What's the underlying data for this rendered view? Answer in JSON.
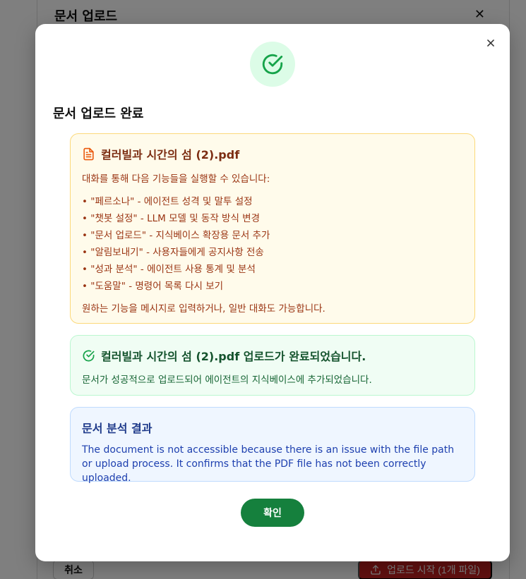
{
  "background": {
    "dialog_title": "문서 업로드",
    "cancel_label": "취소",
    "upload_button_label": "업로드 시작 (1개 파일)"
  },
  "modal": {
    "title": "문서 업로드 완료",
    "info_card": {
      "file_name": "컬러빌과 시간의 섬 (2).pdf",
      "intro": "대화를 통해 다음 기능들을 실행할 수 있습니다:",
      "features": [
        "• \"페르소나\" - 에이전트 성격 및 말투 설정",
        "• \"챗봇 설정\" - LLM 모델 및 동작 방식 변경",
        "• \"문서 업로드\" - 지식베이스 확장용 문서 추가",
        "• \"알림보내기\" - 사용자들에게 공지사항 전송",
        "• \"성과 분석\" - 에이전트 사용 통계 및 분석",
        "• \"도움말\" - 명령어 목록 다시 보기"
      ],
      "outro": "원하는 기능을 메시지로 입력하거나, 일반 대화도 가능합니다."
    },
    "success_card": {
      "title": "컬러빌과 시간의 섬 (2).pdf 업로드가 완료되었습니다.",
      "text": "문서가 성공적으로 업로드되어 에이전트의 지식베이스에 추가되었습니다."
    },
    "analysis_card": {
      "title": "문서 분석 결과",
      "text": "The document is not accessible because there is an issue with the file path or upload process. It confirms that the PDF file has not been correctly uploaded."
    },
    "confirm_label": "확인"
  },
  "icons": {
    "close": "close-icon",
    "success": "check-circle-icon",
    "document": "document-icon",
    "upload": "upload-icon"
  },
  "colors": {
    "success_green": "#15803d",
    "info_yellow_bg": "#fffbeb",
    "info_blue_bg": "#eff6ff",
    "danger_red": "#c32020"
  }
}
